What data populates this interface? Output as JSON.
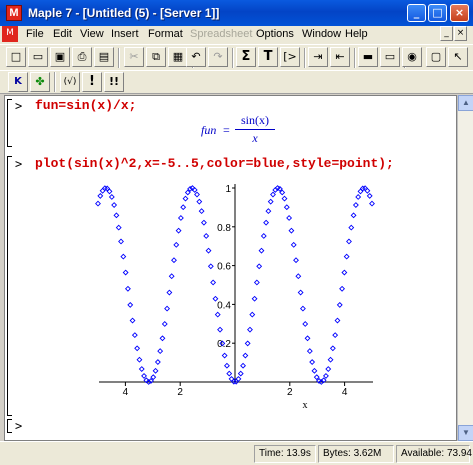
{
  "window": {
    "title": "Maple 7 - [Untitled (5) - [Server 1]]",
    "app_icon_glyph": "M"
  },
  "menu": [
    "File",
    "Edit",
    "View",
    "Insert",
    "Format",
    "Spreadsheet",
    "Options",
    "Window",
    "Help"
  ],
  "toolbar2": {
    "k_label": "K",
    "sqrt_label": "(√)",
    "excl_label": "!",
    "excl2_label": "!!"
  },
  "worksheet": {
    "prompt": ">",
    "line1": "fun=sin(x)/x;",
    "output1": {
      "lhs": "fun",
      "eq": "=",
      "numerator": "sin(x)",
      "denominator": "x"
    },
    "line2": "plot(sin(x)^2,x=-5..5,color=blue,style=point);",
    "line3_prompt": ">"
  },
  "chart_data": {
    "type": "scatter",
    "function": "sin(x)^2",
    "xlim": [
      -5,
      5
    ],
    "ylim": [
      0,
      1
    ],
    "xlabel": "x",
    "ylabel": "",
    "xticks": [
      -4,
      -2,
      2,
      4
    ],
    "xtick_labels": [
      "4",
      "2",
      "2",
      "4"
    ],
    "yticks": [
      0.2,
      0.4,
      0.6,
      0.8,
      1
    ],
    "ytick_labels": [
      "0.2",
      "0.4",
      "0.6",
      "0.8",
      "1"
    ],
    "color": "#0000ff",
    "style": "point",
    "point_marker": "diamond",
    "sample_count": 120
  },
  "status": {
    "time": "Time: 13.9s",
    "bytes": "Bytes: 3.62M",
    "available": "Available: 73.94"
  },
  "colors": {
    "input": "#d00000",
    "output": "#0000c8",
    "plot": "#0000ff"
  }
}
